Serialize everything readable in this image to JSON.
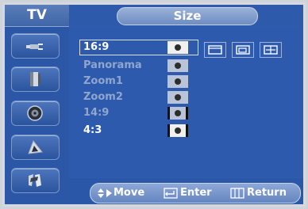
{
  "sidebar": {
    "title": "TV",
    "items": [
      {
        "icon": "antenna-plug-icon"
      },
      {
        "icon": "picture-display-icon"
      },
      {
        "icon": "speaker-sound-icon"
      },
      {
        "icon": "channel-satellite-icon"
      },
      {
        "icon": "setup-tools-icon"
      }
    ]
  },
  "menu": {
    "title": "Size",
    "options": [
      {
        "label": "16:9",
        "state": "selected"
      },
      {
        "label": "Panorama",
        "state": "disabled"
      },
      {
        "label": "Zoom1",
        "state": "disabled"
      },
      {
        "label": "Zoom2",
        "state": "disabled"
      },
      {
        "label": "14:9",
        "state": "disabled"
      },
      {
        "label": "4:3",
        "state": "enabled"
      }
    ],
    "aspect_icons": [
      "wide-frame-icon",
      "position-frame-icon",
      "size-adjust-icon"
    ]
  },
  "footer": {
    "move": "Move",
    "enter": "Enter",
    "return": "Return"
  }
}
